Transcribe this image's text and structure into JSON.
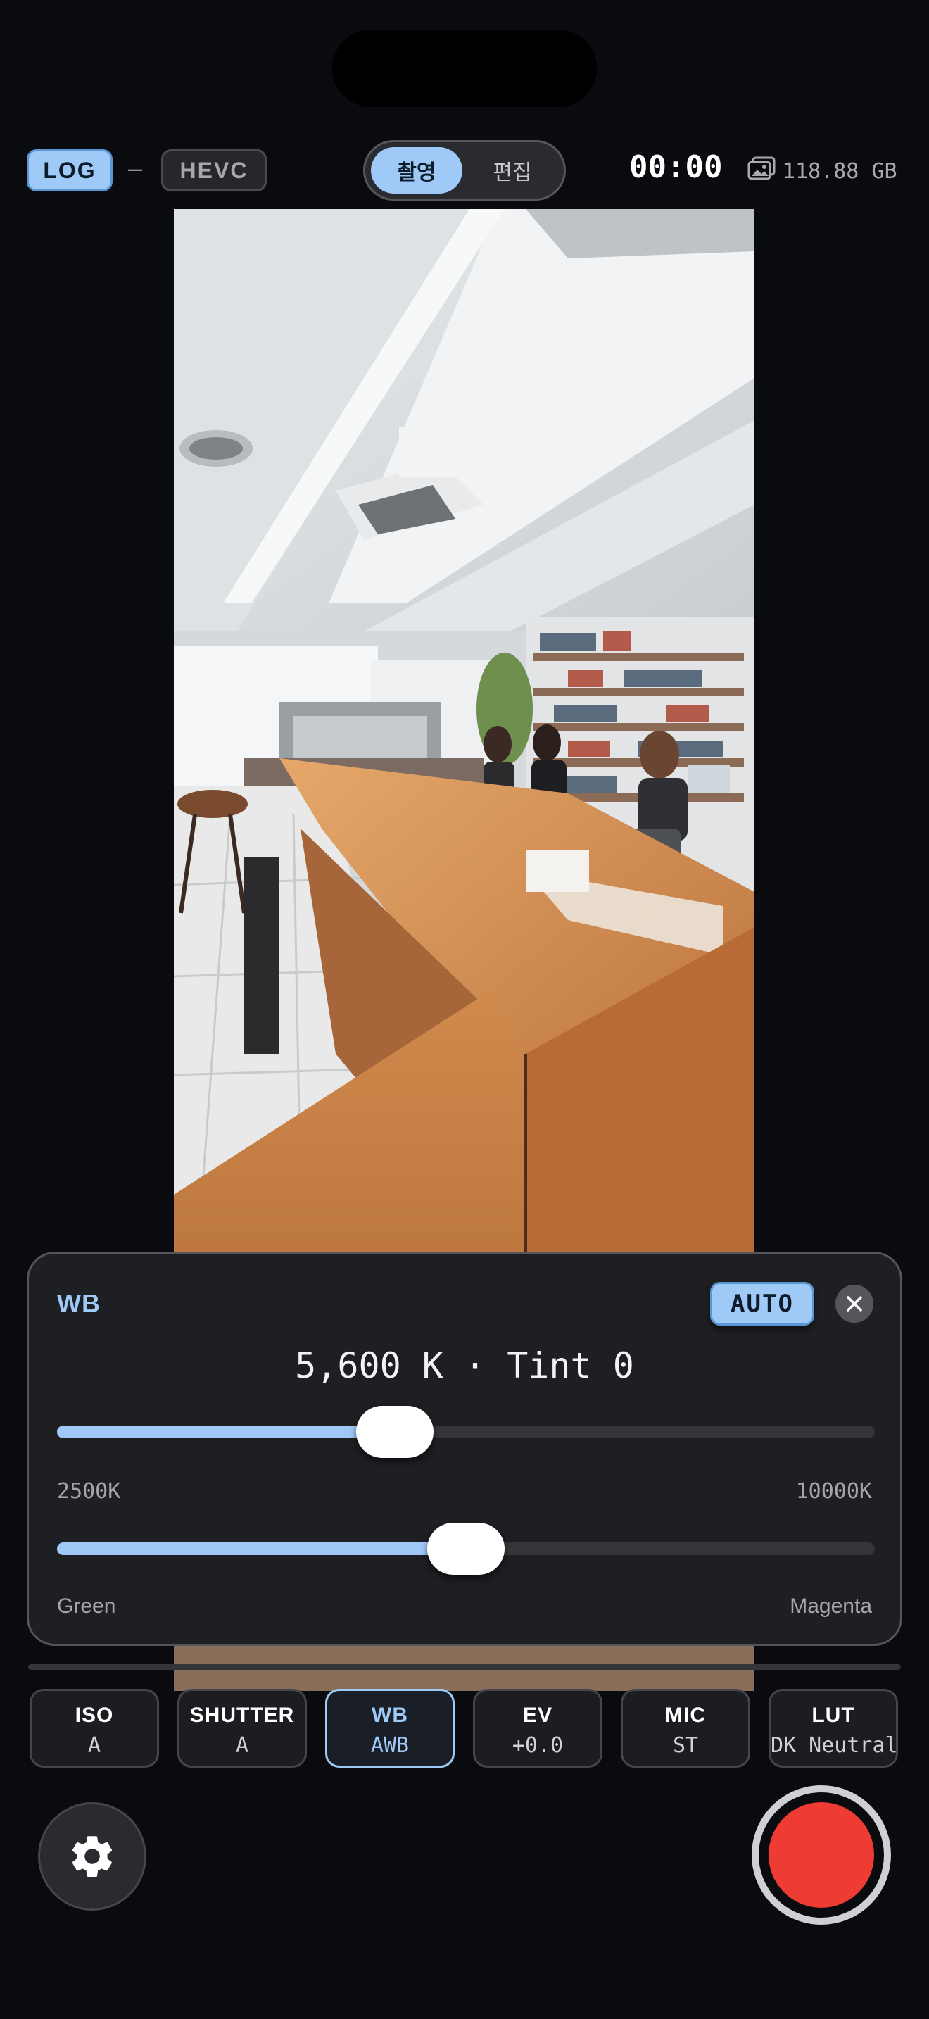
{
  "top_bar": {
    "log_label": "LOG",
    "separator": "–",
    "codec_label": "HEVC",
    "mode_tabs": [
      {
        "label": "촬영",
        "active": true
      },
      {
        "label": "편집",
        "active": false
      }
    ],
    "timer": "00:00",
    "storage_icon": "photo-stack-icon",
    "storage": "118.88 GB"
  },
  "wb_panel": {
    "title": "WB",
    "auto_label": "AUTO",
    "readout": "5,600 K · Tint 0",
    "temperature": {
      "value": 5600,
      "min": 2500,
      "max": 10000,
      "min_label": "2500K",
      "max_label": "10000K"
    },
    "tint": {
      "value": 0,
      "min": -100,
      "max": 100,
      "min_label": "Green",
      "max_label": "Magenta"
    }
  },
  "controls": [
    {
      "title": "ISO",
      "value": "A",
      "active": false
    },
    {
      "title": "SHUTTER",
      "value": "A",
      "active": false
    },
    {
      "title": "WB",
      "value": "AWB",
      "active": true
    },
    {
      "title": "EV",
      "value": "+0.0",
      "active": false
    },
    {
      "title": "MIC",
      "value": "ST",
      "active": false
    },
    {
      "title": "LUT",
      "value": "DK Neutral",
      "active": false
    }
  ],
  "colors": {
    "accent": "#9fcaf7",
    "record": "#ee3b33",
    "background": "#0a0b0f"
  }
}
